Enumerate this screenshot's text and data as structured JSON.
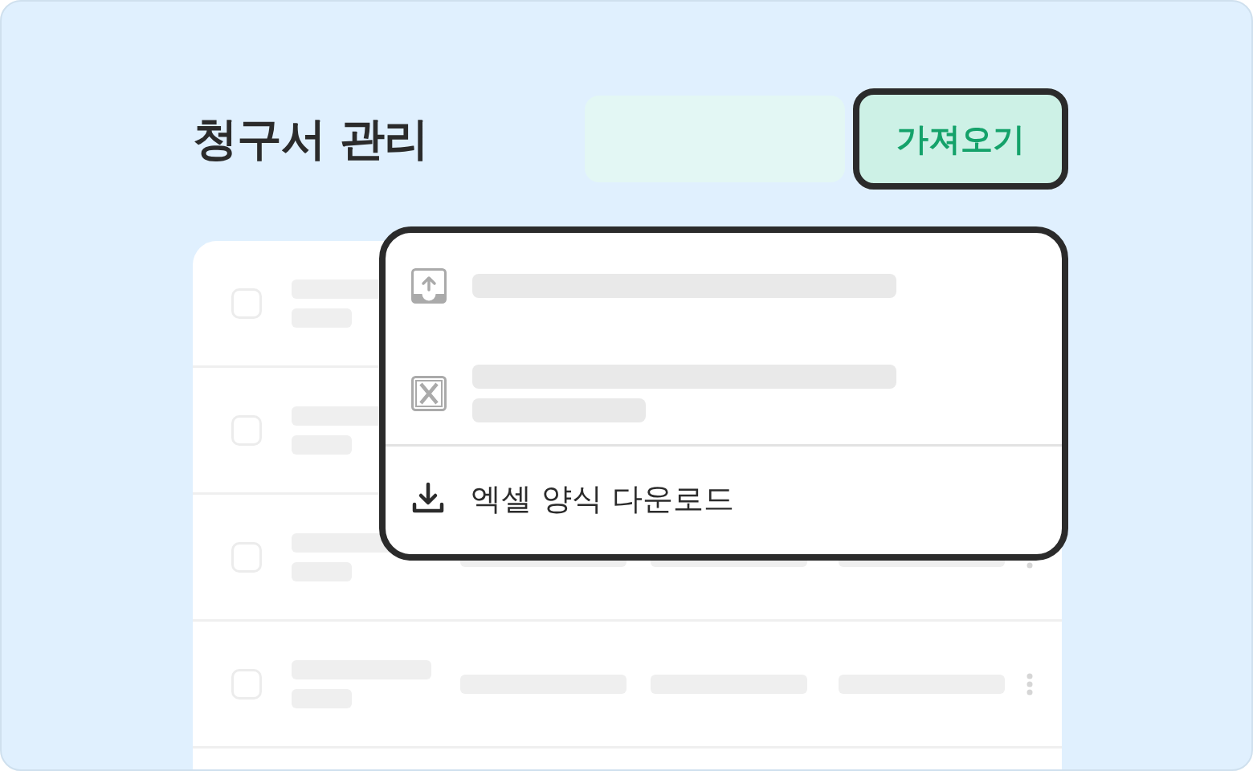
{
  "header": {
    "title": "청구서 관리",
    "import_button": {
      "label": "가져오기",
      "expanded": true
    }
  },
  "menu": {
    "items": [
      {
        "kind": "upload"
      },
      {
        "kind": "excel"
      },
      {
        "kind": "download",
        "label": "엑셀 양식 다운로드"
      }
    ]
  },
  "table": {
    "rows": [
      {
        "checked": false
      },
      {
        "checked": false
      },
      {
        "checked": false
      },
      {
        "checked": false
      }
    ]
  }
}
